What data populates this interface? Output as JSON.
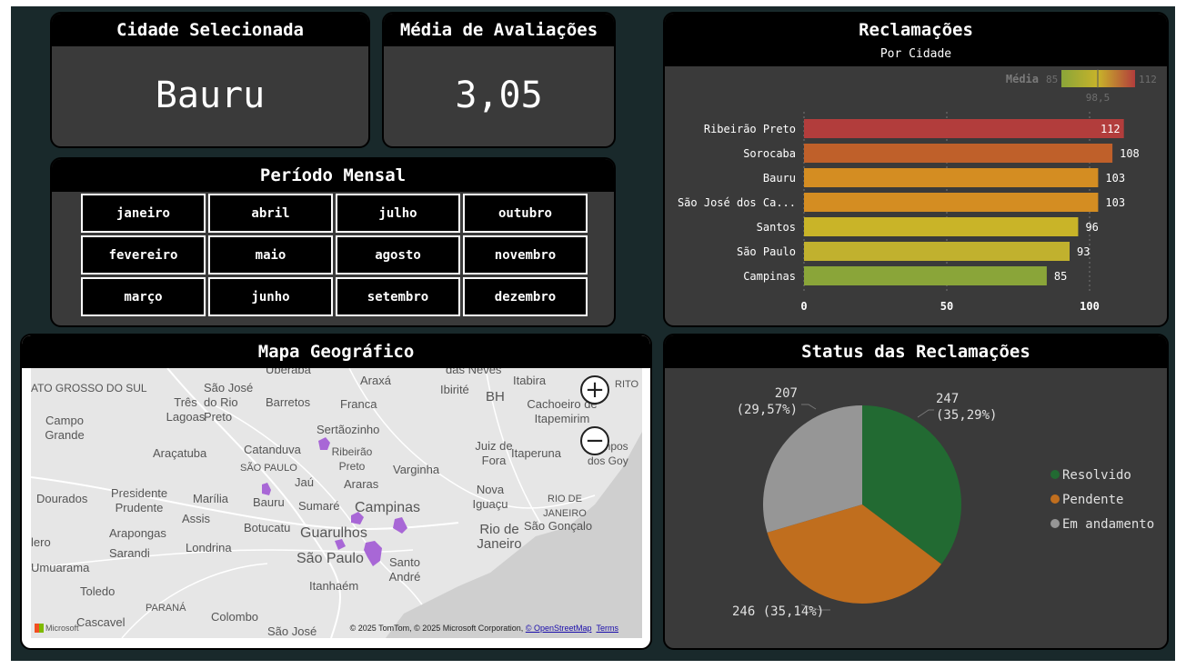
{
  "kpi_city": {
    "title": "Cidade Selecionada",
    "value": "Bauru"
  },
  "kpi_rating": {
    "title": "Média de Avaliações",
    "value": "3,05"
  },
  "period": {
    "title": "Período Mensal",
    "months": [
      "janeiro",
      "abril",
      "julho",
      "outubro",
      "fevereiro",
      "maio",
      "agosto",
      "novembro",
      "março",
      "junho",
      "setembro",
      "dezembro"
    ]
  },
  "map": {
    "title": "Mapa Geográfico",
    "zoom_in": "+",
    "zoom_out": "−",
    "attribution": "© 2025 TomTom, © 2025 Microsoft Corporation,",
    "osm_link": "© OpenStreetMap",
    "terms_link": "Terms",
    "logo": "Microsoft",
    "places": [
      "Uberaba",
      "Araxá",
      "das Neves",
      "Itabira",
      "RITO",
      "ATO GROSSO DO SUL",
      "São José do Rio Preto",
      "Três Lagoas",
      "Barretos",
      "Franca",
      "Ibirité",
      "BH",
      "Cachoeiro de Itapemirim",
      "Campo Grande",
      "Sertãozinho",
      "Ribeirão Preto",
      "Araçatuba",
      "Catanduva",
      "Juiz de Fora",
      "Itaperuna",
      "Campos dos Goy",
      "SÃO PAULO",
      "Jaú",
      "Araras",
      "Varginha",
      "Dourados",
      "Presidente Prudente",
      "Marília",
      "Bauru",
      "Sumaré",
      "Campinas",
      "Nova Iguaçu",
      "RIO DE JANEIRO",
      "Assis",
      "Botucatu",
      "Rio de Janeiro",
      "São Gonçalo",
      "Arapongas",
      "Guarulhos",
      "lero",
      "Sarandi",
      "Londrina",
      "Umuarama",
      "São Paulo",
      "Santo André",
      "Toledo",
      "Itanhaém",
      "PARANÁ",
      "Cascavel",
      "Colombo",
      "São José"
    ]
  },
  "complaints": {
    "title": "Reclamações",
    "subtitle": "Por Cidade",
    "legend": {
      "label": "Média",
      "min": "85",
      "mid": "98,5",
      "max": "112"
    },
    "colors": {
      "low": "#8aa539",
      "mid": "#c8b32a",
      "high": "#b23d3c"
    }
  },
  "chart_data": [
    {
      "type": "bar",
      "orientation": "horizontal",
      "title": "Reclamações",
      "subtitle": "Por Cidade",
      "categories": [
        "Ribeirão Preto",
        "Sorocaba",
        "Bauru",
        "São José dos Ca...",
        "Santos",
        "São Paulo",
        "Campinas"
      ],
      "values": [
        112,
        108,
        103,
        103,
        96,
        93,
        85
      ],
      "colors": [
        "#b23d3c",
        "#bf602a",
        "#d48d22",
        "#d48d22",
        "#c9b428",
        "#c1b12e",
        "#8aa539"
      ],
      "xticks": [
        "0",
        "50",
        "100"
      ],
      "xlim": [
        0,
        120
      ],
      "grid": "dashed vertical"
    },
    {
      "type": "pie",
      "title": "Status das Reclamações",
      "labels": [
        "Resolvido",
        "Pendente",
        "Em andamento"
      ],
      "values": [
        247,
        246,
        207
      ],
      "percent_labels": [
        "247 (35,29%)",
        "246 (35,14%)",
        "207 (29,57%)"
      ],
      "colors": [
        "#226a32",
        "#c06e1e",
        "#969696"
      ],
      "legend": "right"
    }
  ],
  "status": {
    "title": "Status das Reclamações"
  }
}
